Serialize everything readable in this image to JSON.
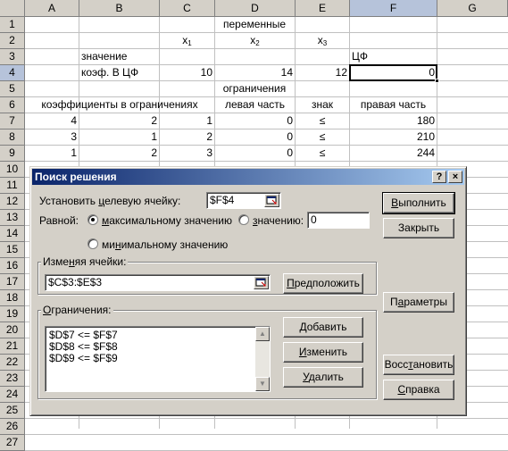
{
  "sheet": {
    "columns": [
      "A",
      "B",
      "C",
      "D",
      "E",
      "F",
      "G"
    ],
    "rows": [
      "1",
      "2",
      "3",
      "4",
      "5",
      "6",
      "7",
      "8",
      "9",
      "10",
      "11",
      "12",
      "13",
      "14",
      "15",
      "16",
      "17",
      "18",
      "19",
      "20",
      "21",
      "22",
      "23",
      "24",
      "25",
      "26",
      "27"
    ],
    "cells": {
      "C1": "переменные",
      "C2": "x",
      "C2_sub": "1",
      "D2": "x",
      "D2_sub": "2",
      "E2": "x",
      "E2_sub": "3",
      "B3": "значение",
      "F3": "ЦФ",
      "B4": "коэф. В ЦФ",
      "C4": "10",
      "D4": "14",
      "E4": "12",
      "F4": "0",
      "C5": "ограничения",
      "A6": "коэффициенты в ограничениях",
      "D6": "левая часть",
      "E6": "знак",
      "F6": "правая часть",
      "A7": "4",
      "B7": "2",
      "C7": "1",
      "D7": "0",
      "E7": "≤",
      "F7": "180",
      "A8": "3",
      "B8": "1",
      "C8": "2",
      "D8": "0",
      "E8": "≤",
      "F8": "210",
      "A9": "1",
      "B9": "2",
      "C9": "3",
      "D9": "0",
      "E9": "≤",
      "F9": "244"
    }
  },
  "dialog": {
    "title": "Поиск решения",
    "help_glyph": "?",
    "close_glyph": "×",
    "target_label_pre": "Установить ",
    "target_label_u": "ц",
    "target_label_post": "елевую ячейку:",
    "target_value": "$F$4",
    "equal_label": "Равной:",
    "radio_max_pre": "",
    "radio_max_u": "м",
    "radio_max_post": "аксимальному значению",
    "radio_value_pre": "",
    "radio_value_u": "з",
    "radio_value_post": "начению:",
    "value_field": "0",
    "radio_min_pre": "ми",
    "radio_min_u": "н",
    "radio_min_post": "имальному значению",
    "changing_group_pre": "Изме",
    "changing_group_u": "н",
    "changing_group_post": "яя ячейки:",
    "changing_value": "$C$3:$E$3",
    "guess_label_pre": "",
    "guess_label_u": "П",
    "guess_label_post": "редположить",
    "constraints_group_pre": "",
    "constraints_group_u": "О",
    "constraints_group_post": "граничения:",
    "constraints": [
      "$D$7 <= $F$7",
      "$D$8 <= $F$8",
      "$D$9 <= $F$9"
    ],
    "add_pre": "",
    "add_u": "Д",
    "add_post": "обавить",
    "change_pre": "",
    "change_u": "И",
    "change_post": "зменить",
    "delete_pre": "",
    "delete_u": "У",
    "delete_post": "далить",
    "solve_pre": "",
    "solve_u": "В",
    "solve_post": "ыполнить",
    "close_label": "Закрыть",
    "options_label_pre": "П",
    "options_label_u": "а",
    "options_label_post": "раметры",
    "reset_label_pre": "Восс",
    "reset_label_u": "т",
    "reset_label_post": "ановить",
    "help_label_pre": "",
    "help_label_u": "С",
    "help_label_post": "правка"
  }
}
